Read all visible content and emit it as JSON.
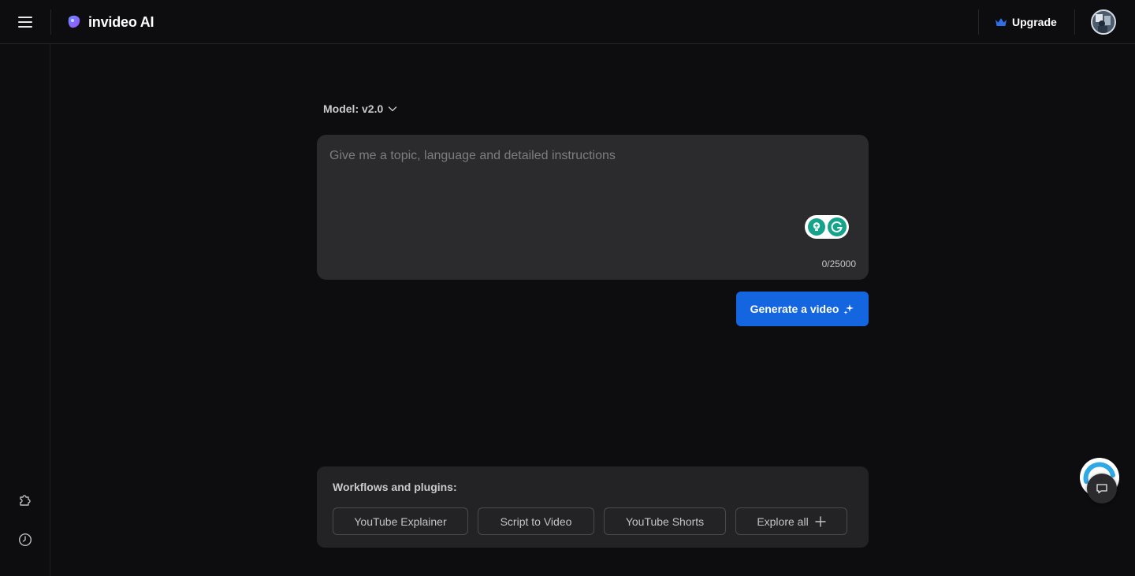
{
  "app": {
    "brand_name": "invideo AI",
    "upgrade_label": "Upgrade",
    "accent_color": "#1466e0"
  },
  "icons": {
    "menu": "hamburger-icon",
    "logo": "invideo-logo-icon",
    "upgrade": "crown-icon",
    "plugins": "puzzle-icon",
    "history": "clock-icon",
    "model_dropdown": "chevron-down-icon",
    "generate": "sparkle-icon",
    "explore": "plus-icon",
    "chat": "chat-icon"
  },
  "model": {
    "label": "Model: v2.0"
  },
  "prompt": {
    "placeholder": "Give me a topic, language and detailed instructions",
    "value": "",
    "char_count": "0/25000"
  },
  "generate": {
    "label": "Generate a video"
  },
  "workflows": {
    "title": "Workflows and plugins:",
    "chips": [
      {
        "label": "YouTube Explainer"
      },
      {
        "label": "Script to Video"
      },
      {
        "label": "YouTube Shorts"
      },
      {
        "label": "Explore all"
      }
    ]
  }
}
